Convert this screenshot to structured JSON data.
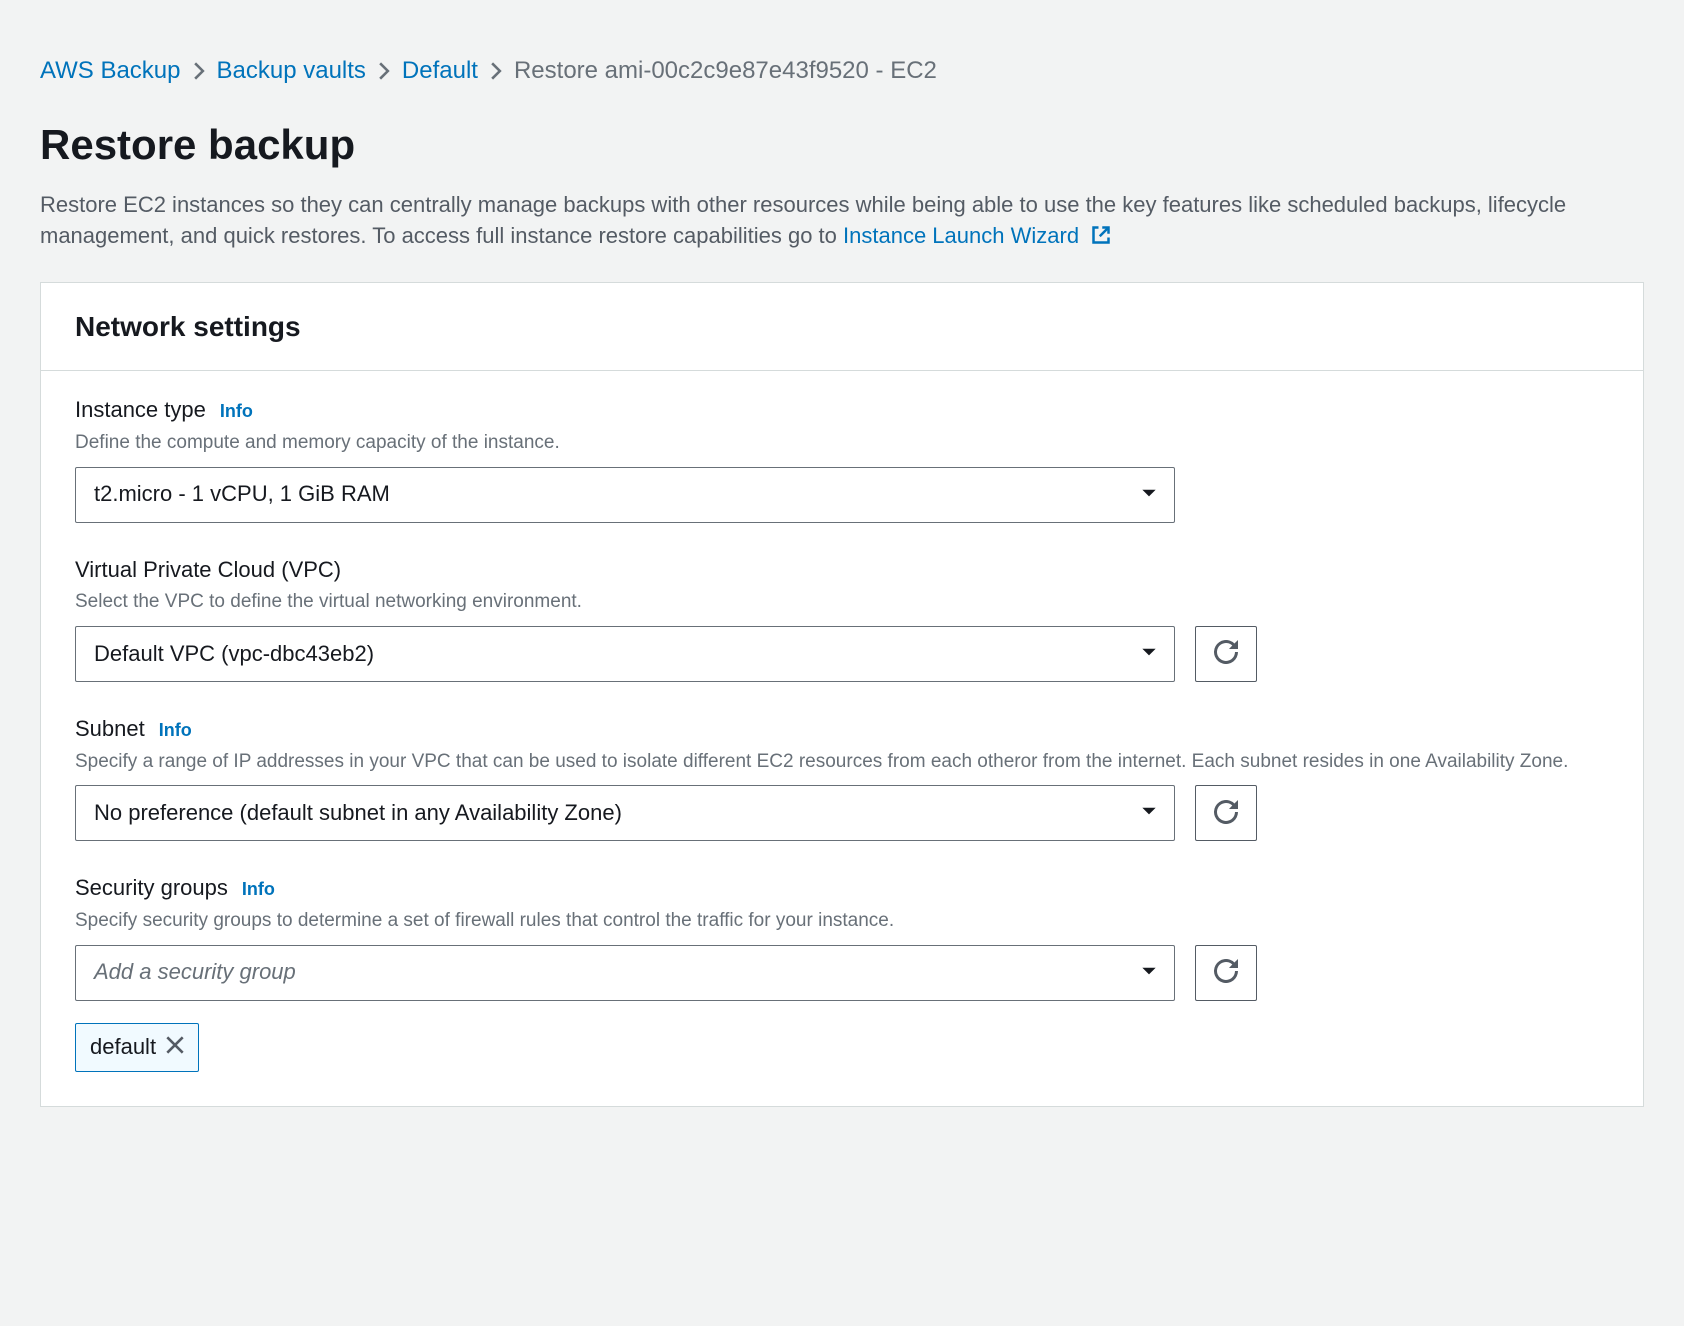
{
  "breadcrumb": {
    "items": [
      {
        "label": "AWS Backup"
      },
      {
        "label": "Backup vaults"
      },
      {
        "label": "Default"
      }
    ],
    "current": "Restore ami-00c2c9e87e43f9520 - EC2"
  },
  "page": {
    "title": "Restore backup",
    "description_pre": "Restore EC2 instances so they can centrally manage backups with other resources while being able to use the key features like scheduled backups, lifecycle management, and quick restores. To access full instance restore capabilities go to ",
    "description_link": "Instance Launch Wizard"
  },
  "panel": {
    "title": "Network settings"
  },
  "info_label": "Info",
  "fields": {
    "instance_type": {
      "label": "Instance type",
      "help": "Define the compute and memory capacity of the instance.",
      "value": "t2.micro - 1 vCPU, 1 GiB RAM"
    },
    "vpc": {
      "label": "Virtual Private Cloud (VPC)",
      "help": "Select the VPC to define the virtual networking environment.",
      "value": "Default VPC (vpc-dbc43eb2)"
    },
    "subnet": {
      "label": "Subnet",
      "help": "Specify a range of IP addresses in your VPC that can be used to isolate different EC2 resources from each otheror from the internet. Each subnet resides in one Availability Zone.",
      "value": "No preference (default subnet in any Availability Zone)"
    },
    "security_groups": {
      "label": "Security groups",
      "help": "Specify security groups to determine a set of firewall rules that control the traffic for your instance.",
      "placeholder": "Add a security group",
      "tokens": [
        "default"
      ]
    }
  }
}
